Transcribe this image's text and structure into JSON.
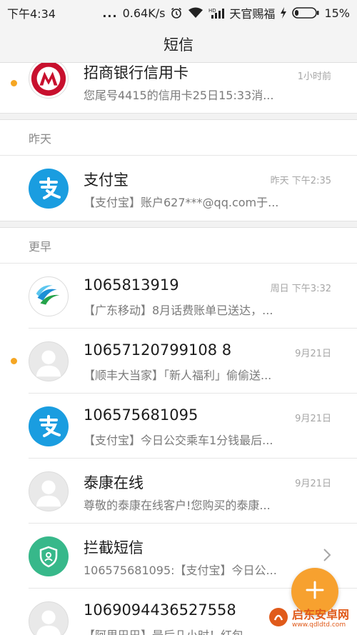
{
  "status_bar": {
    "time": "下午4:34",
    "dots": "...",
    "speed": "0.64K/s",
    "carrier": "天官赐福",
    "battery": "15%",
    "icons": [
      "alarm-icon",
      "wifi-icon",
      "hd-signal-icon",
      "charging-icon",
      "battery-icon"
    ]
  },
  "header": {
    "title": "短信"
  },
  "conversations_top": [
    {
      "name": "招商银行信用卡",
      "preview": "您尾号4415的信用卡25日15:33消...",
      "time": "1小时前",
      "unread": true,
      "avatar": "cmb-logo"
    }
  ],
  "sections": [
    {
      "label": "昨天",
      "items": [
        {
          "name": "支付宝",
          "preview": "【支付宝】账户627***@qq.com于...",
          "time": "昨天 下午2:35",
          "unread": false,
          "avatar": "alipay-logo"
        }
      ]
    },
    {
      "label": "更早",
      "items": [
        {
          "name": "1065813919",
          "preview": "【广东移动】8月话费账单已送达，...",
          "time": "周日 下午3:32",
          "unread": false,
          "avatar": "china-mobile-logo"
        },
        {
          "name": "10657120799108 8",
          "preview": "【顺丰大当家】「新人福利」偷偷送...",
          "time": "9月21日",
          "unread": true,
          "avatar": "default-avatar"
        },
        {
          "name": "106575681095",
          "preview": "【支付宝】今日公交乘车1分钱最后...",
          "time": "9月21日",
          "unread": false,
          "avatar": "alipay-logo"
        },
        {
          "name": "泰康在线",
          "preview": "尊敬的泰康在线客户!您购买的泰康...",
          "time": "9月21日",
          "unread": false,
          "avatar": "default-avatar"
        },
        {
          "name": "拦截短信",
          "preview": "106575681095:【支付宝】今日公...",
          "time": "",
          "unread": false,
          "avatar": "shield-logo",
          "chevron": true
        },
        {
          "name": "1069094436527558",
          "preview": "【阿里巴巴】最后几小时！红包...",
          "time": "",
          "unread": false,
          "avatar": "default-avatar"
        }
      ]
    }
  ],
  "fab": {
    "icon": "plus-icon"
  },
  "watermark": {
    "main": "启东安卓网",
    "sub": "www.qdldtd.com"
  },
  "colors": {
    "accent": "#f7a12f",
    "alipay": "#1a9de0",
    "blocked": "#37b88a",
    "cmb_red": "#c8102e",
    "unread_dot": "#f5a623"
  }
}
